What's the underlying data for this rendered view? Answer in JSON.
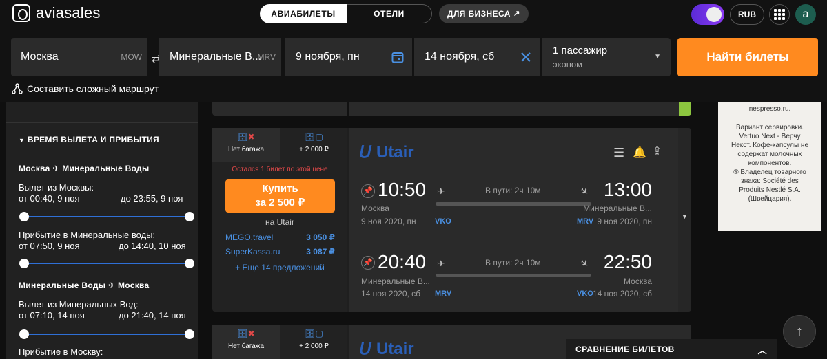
{
  "header": {
    "logo_text": "aviasales",
    "tabs": [
      "АВИАБИЛЕТЫ",
      "ОТЕЛИ"
    ],
    "business_label": "ДЛЯ БИЗНЕСА ↗",
    "currency": "RUB",
    "avatar_letter": "a"
  },
  "search": {
    "origin": "Москва",
    "origin_code": "MOW",
    "destination": "Минеральные В...",
    "destination_code": "MRV",
    "depart_date": "9 ноября, пн",
    "return_date": "14 ноября, сб",
    "passengers": "1 пассажир",
    "class": "эконом",
    "find_label": "Найти билеты",
    "complex_route": "Составить сложный маршрут"
  },
  "filters": {
    "section_title": "ВРЕМЯ ВЫЛЕТА И ПРИБЫТИЯ",
    "leg1_from": "Москва",
    "leg1_to": "Минеральные Воды",
    "leg1_departure_label": "Вылет из Москвы:",
    "leg1_departure_from": "от 00:40, 9 ноя",
    "leg1_departure_to": "до 23:55, 9 ноя",
    "leg1_arrival_label": "Прибытие в Минеральные воды:",
    "leg1_arrival_from": "от 07:50, 9 ноя",
    "leg1_arrival_to": "до 14:40, 10 ноя",
    "leg2_from": "Минеральные Воды",
    "leg2_to": "Москва",
    "leg2_departure_label": "Вылет из Минеральных Вод:",
    "leg2_departure_from": "от 07:10, 14 ноя",
    "leg2_departure_to": "до 21:40, 14 ноя",
    "leg2_arrival_label": "Прибытие в Москву:"
  },
  "ticket": {
    "baggage_none": "Нет багажа",
    "baggage_price": "+ 2 000 ₽",
    "last_ticket_note": "Остался 1 билет по этой цене",
    "buy_label": "Купить",
    "buy_price": "за 2 500 ₽",
    "seller": "на Utair",
    "offers": [
      {
        "name": "MEGO.travel",
        "price": "3 050 ₽"
      },
      {
        "name": "SuperKassa.ru",
        "price": "3 087 ₽"
      }
    ],
    "more_offers": "+ Еще 14 предложений",
    "airline": "Utair",
    "outbound": {
      "dep_time": "10:50",
      "arr_time": "13:00",
      "duration": "В пути: 2ч 10м",
      "dep_city": "Москва",
      "arr_city": "Минеральные В...",
      "dep_date": "9 ноя 2020, пн",
      "arr_date": "9 ноя 2020, пн",
      "dep_code": "VKO",
      "arr_code": "MRV"
    },
    "inbound": {
      "dep_time": "20:40",
      "arr_time": "22:50",
      "duration": "В пути: 2ч 10м",
      "dep_city": "Минеральные В...",
      "arr_city": "Москва",
      "dep_date": "14 ноя 2020, сб",
      "arr_date": "14 ноя 2020, сб",
      "dep_code": "MRV",
      "arr_code": "VKO"
    }
  },
  "ticket2": {
    "baggage_none": "Нет багажа",
    "baggage_price": "+ 2 000 ₽",
    "airline": "Utair"
  },
  "ad": {
    "lines": [
      "nespresso.ru.",
      "Вариант сервировки.",
      "Vertuo Next - Верчу",
      "Некст. Кофе-капсулы не",
      "содержат молочных",
      "компонентов.",
      "® Владелец товарного",
      "знака: Société des",
      "Produits Nestlé S.A.",
      "(Швейцария)."
    ]
  },
  "compare_label": "СРАВНЕНИЕ БИЛЕТОВ",
  "colors": {
    "accent": "#ff8a1f",
    "blue": "#4a90e2",
    "toggle": "#7a35ee"
  }
}
